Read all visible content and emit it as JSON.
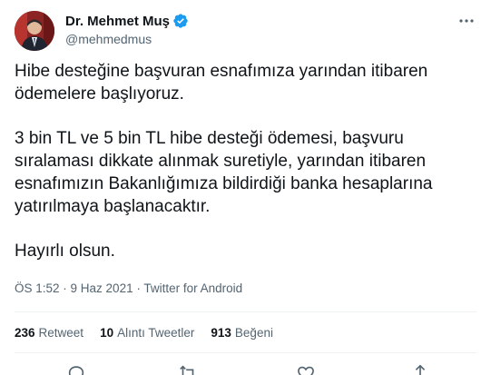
{
  "author": {
    "display_name": "Dr. Mehmet Muş",
    "handle": "@mehmedmus"
  },
  "tweet": {
    "paragraphs": [
      "Hibe desteğine başvuran esnafımıza yarından itibaren\nödemelere başlıyoruz.",
      "3 bin TL ve 5 bin TL hibe desteği ödemesi, başvuru\nsıralaması dikkate alınmak suretiyle, yarından itibaren\nesnafımızın Bakanlığımıza bildirdiği banka hesaplarına\nyatırılmaya başlanacaktır.",
      "Hayırlı olsun."
    ]
  },
  "meta": {
    "time": "ÖS 1:52",
    "separator": " · ",
    "date": "9 Haz 2021",
    "source": "Twitter for Android"
  },
  "stats": {
    "retweets_count": "236",
    "retweets_label": "Retweet",
    "quotes_count": "10",
    "quotes_label": "Alıntı Tweetler",
    "likes_count": "913",
    "likes_label": "Beğeni"
  },
  "icons": {
    "verified": "verified-badge-icon",
    "more": "more-dots-icon",
    "reply": "reply-icon",
    "retweet": "retweet-icon",
    "like": "heart-icon",
    "share": "share-icon"
  },
  "colors": {
    "verified": "#1d9bf0",
    "text_primary": "#0f1419",
    "text_secondary": "#536471",
    "divider": "#eff3f4"
  }
}
